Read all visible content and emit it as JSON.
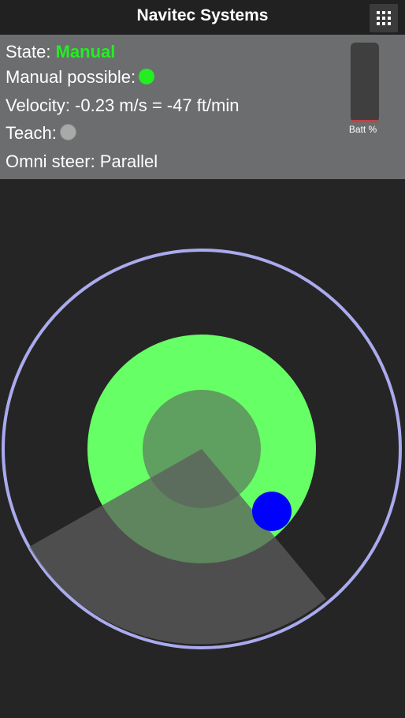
{
  "header": {
    "title": "Navitec Systems",
    "menu_icon": "grid-menu-icon"
  },
  "status": {
    "state_label": "State:",
    "state_value": "Manual",
    "state_color": "#22ee22",
    "manual_possible_label": "Manual possible:",
    "manual_possible_led_color": "#22ee22",
    "velocity_text": "Velocity: -0.23 m/s = -47 ft/min",
    "teach_label": "Teach:",
    "teach_led_color": "#a9a9a9",
    "omni_steer_text": "Omni steer: Parallel"
  },
  "battery": {
    "label": "Batt %",
    "level": 0.03,
    "fill_color": "#c24242"
  },
  "joystick": {
    "ring_color": "#aaaaee",
    "zone_color": "#66ff66",
    "inner_color": "#5f9f5f",
    "sector_color": "#5c5c5c",
    "knob_color": "#0000ff"
  }
}
